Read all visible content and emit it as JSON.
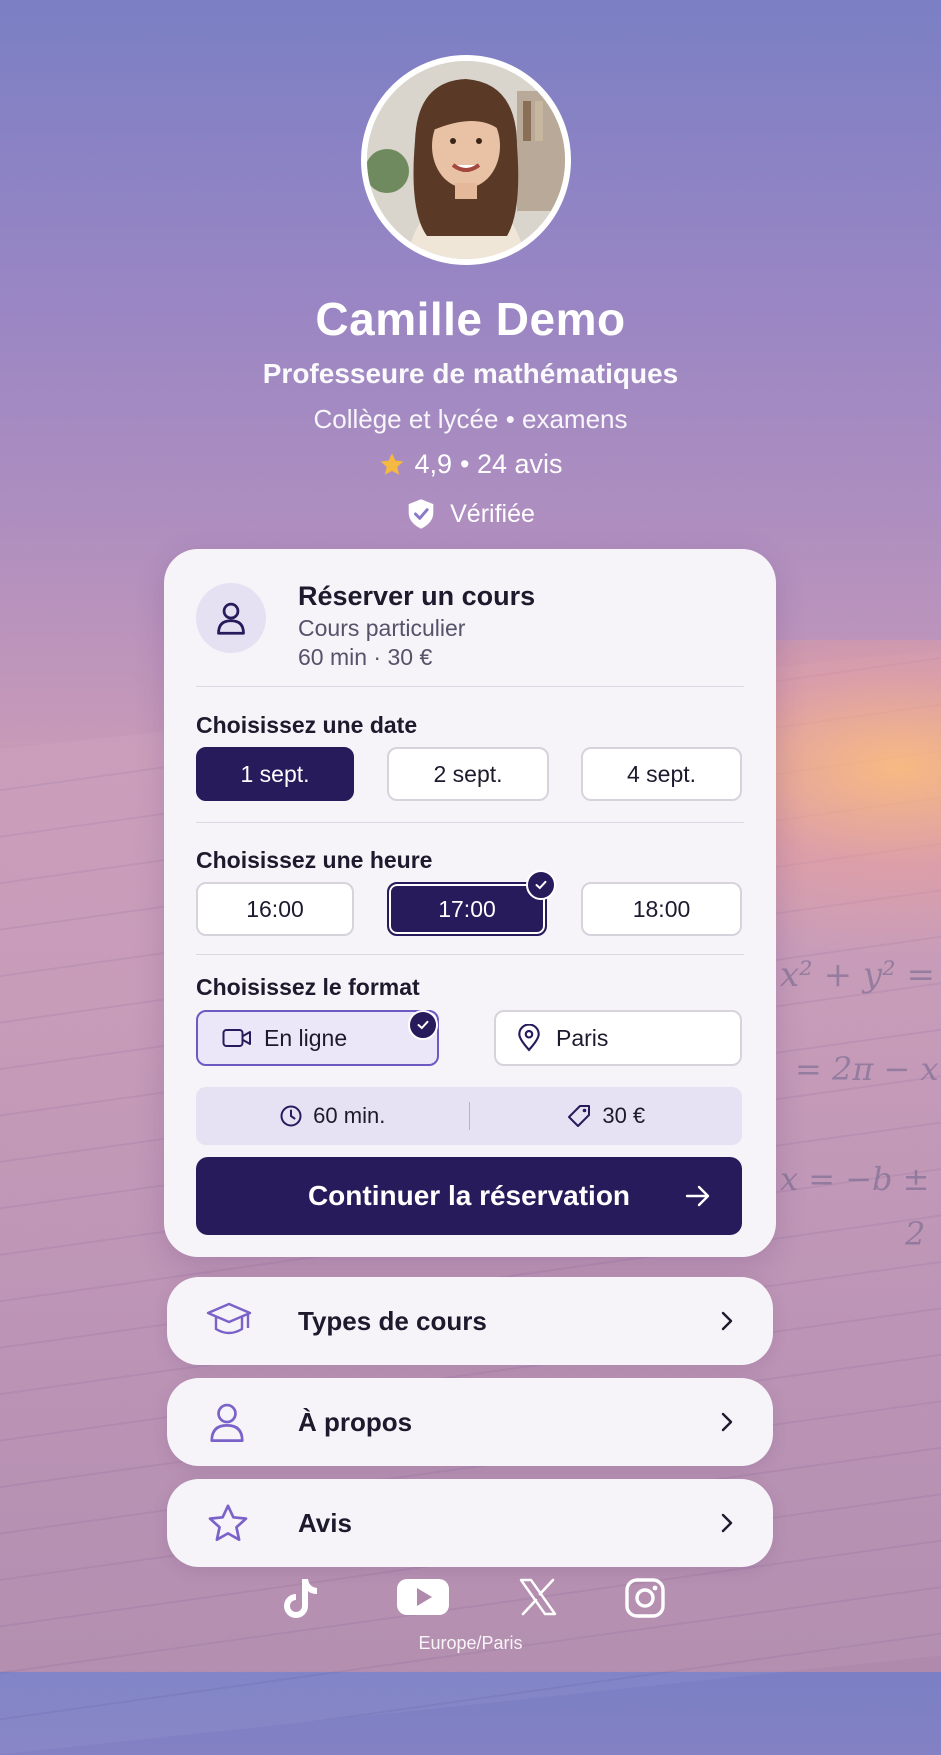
{
  "profile": {
    "name": "Camille Demo",
    "title": "Professeure de mathématiques",
    "subtitle": "Collège et lycée • examens",
    "rating": "4,9",
    "reviews": "• 24 avis",
    "verified": "Vérifiée"
  },
  "booking": {
    "title": "Réserver un cours",
    "type": "Cours particulier",
    "meta": "60 min · 30 €",
    "date_label": "Choisissez une date",
    "dates": [
      "1 sept.",
      "2 sept.",
      "4 sept."
    ],
    "selected_date": "1 sept.",
    "time_label": "Choisissez une heure",
    "times": [
      "16:00",
      "17:00",
      "18:00"
    ],
    "selected_time": "17:00",
    "format_label": "Choisissez le format",
    "formats": [
      "En ligne",
      "Paris"
    ],
    "selected_format": "En ligne",
    "summary_duration": "60 min.",
    "summary_price": "30 €",
    "cta": "Continuer la réservation"
  },
  "menu": [
    {
      "label": "Types de cours",
      "icon": "graduation-cap-icon"
    },
    {
      "label": "À propos",
      "icon": "user-icon"
    },
    {
      "label": "Avis",
      "icon": "star-icon"
    }
  ],
  "socials": [
    "tiktok-icon",
    "youtube-icon",
    "x-icon",
    "instagram-icon"
  ],
  "timezone": "Europe/Paris",
  "colors": {
    "primary": "#271b5c",
    "accent": "#7a62c9",
    "star": "#f5b942"
  }
}
